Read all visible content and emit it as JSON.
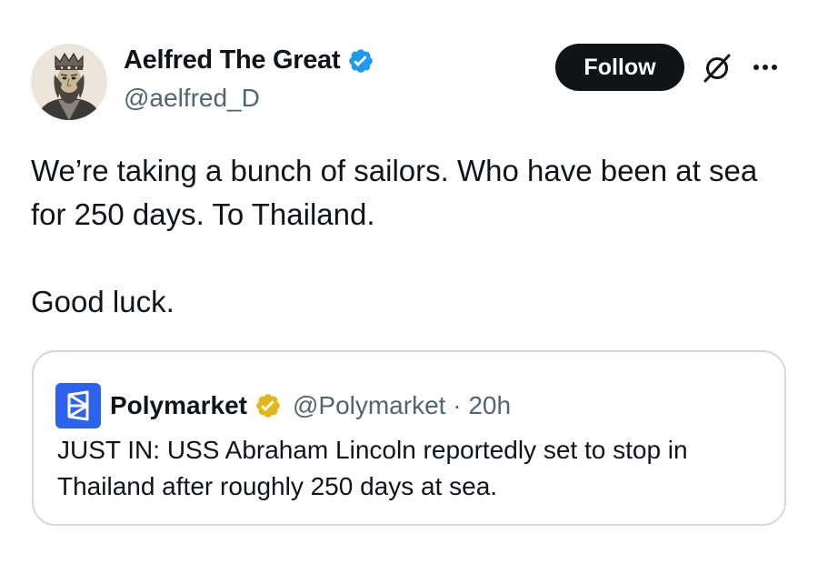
{
  "author": {
    "display_name": "Aelfred The Great",
    "handle": "@aelfred_D",
    "verified": true
  },
  "actions": {
    "follow_label": "Follow",
    "grok_icon": "grok-icon",
    "more_icon": "more-options-icon"
  },
  "tweet": {
    "paragraphs": [
      "We’re taking a bunch of sailors. Who have been at sea for 250 days. To Thailand.",
      "Good luck."
    ]
  },
  "quote": {
    "display_name": "Polymarket",
    "meta": "@Polymarket · 20h",
    "verified": "gold",
    "text": "JUST IN: USS Abraham Lincoln reportedly set to stop in Thailand after roughly 250 days at sea."
  },
  "colors": {
    "text": "#0f1419",
    "muted": "#536471",
    "verified_blue": "#1d9bf0",
    "verified_gold": "#e2b719",
    "polymarket_blue": "#2d62ec",
    "border": "#cfd9de"
  }
}
